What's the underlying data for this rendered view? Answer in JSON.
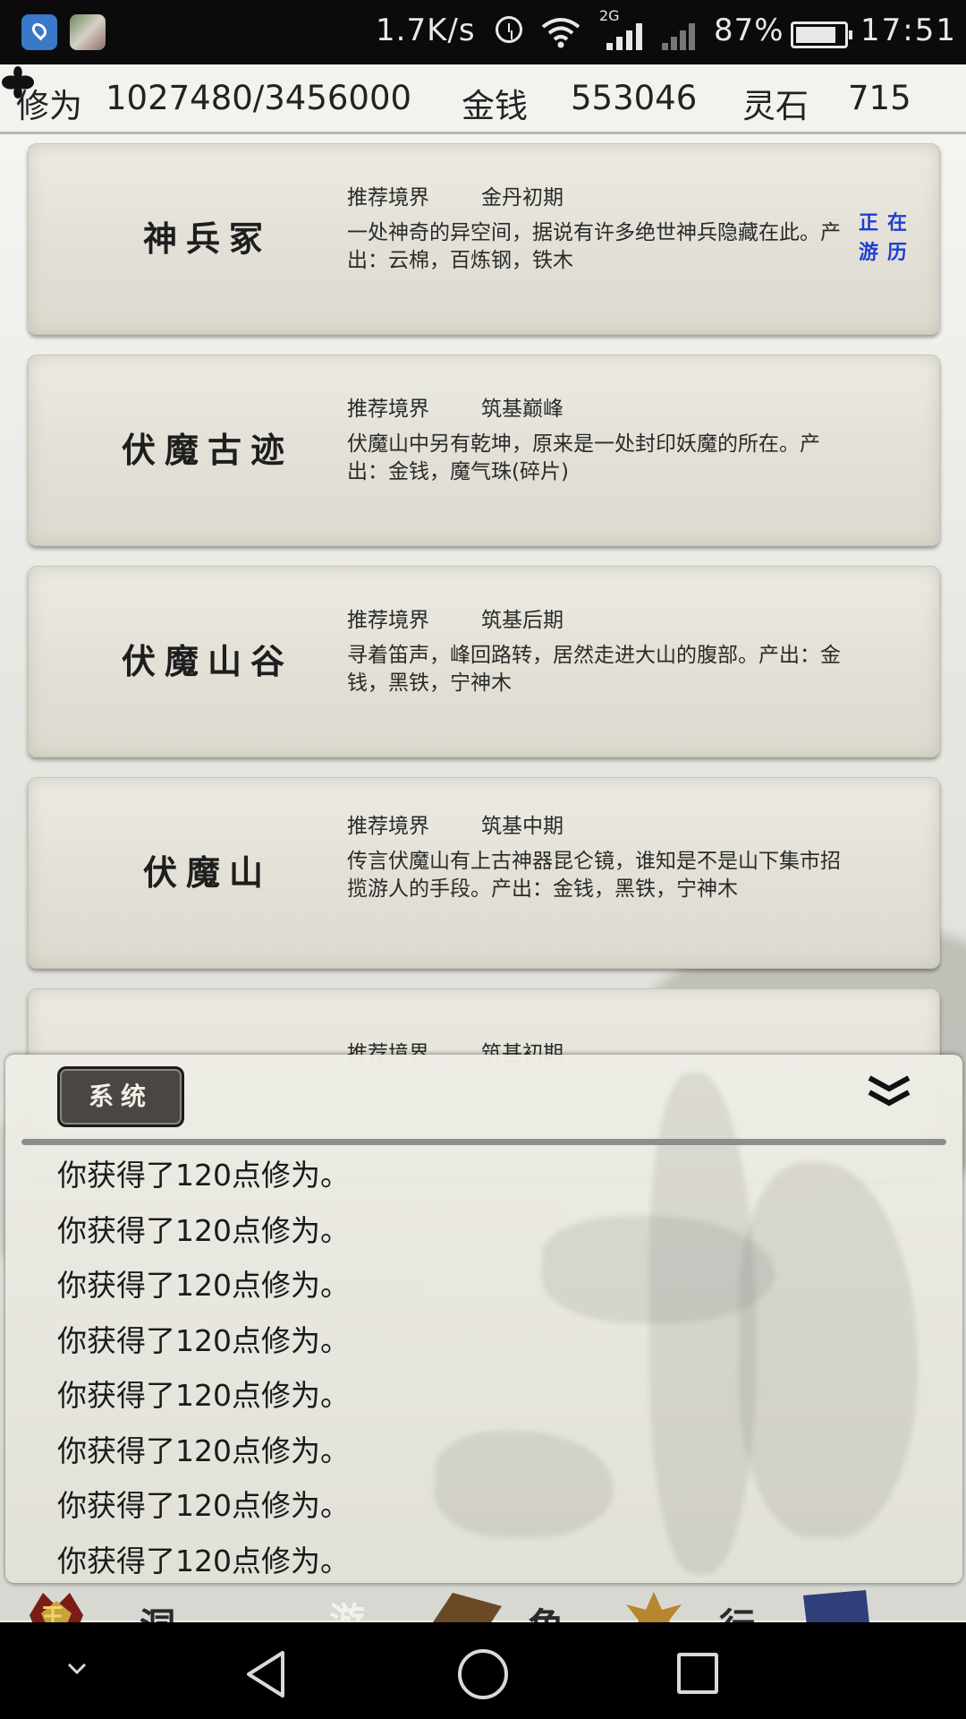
{
  "status_bar": {
    "speed": "1.7K/s",
    "network_type": "2G",
    "battery": "87%",
    "time": "17:51"
  },
  "resources": {
    "cultivation_label": "修为",
    "cultivation_value": "1027480/3456000",
    "money_label": "金钱",
    "money_value": "553046",
    "spirit_stone_label": "灵石",
    "spirit_stone_value": "715"
  },
  "locations": [
    {
      "name": "神兵冢",
      "rec_label": "推荐境界",
      "rec_value": "金丹初期",
      "desc": "一处神奇的异空间，据说有许多绝世神兵隐藏在此。产出：云棉，百炼钢，铁木",
      "status": "正在游历"
    },
    {
      "name": "伏魔古迹",
      "rec_label": "推荐境界",
      "rec_value": "筑基巅峰",
      "desc": "伏魔山中另有乾坤，原来是一处封印妖魔的所在。产出：金钱，魔气珠(碎片)"
    },
    {
      "name": "伏魔山谷",
      "rec_label": "推荐境界",
      "rec_value": "筑基后期",
      "desc": "寻着笛声，峰回路转，居然走进大山的腹部。产出：金钱，黑铁，宁神木"
    },
    {
      "name": "伏魔山",
      "rec_label": "推荐境界",
      "rec_value": "筑基中期",
      "desc": "传言伏魔山有上古神器昆仑镜，谁知是不是山下集市招揽游人的手段。产出：金钱，黑铁，宁神木"
    },
    {
      "name": "",
      "rec_label": "推荐境界",
      "rec_value": "筑基初期",
      "desc": ""
    }
  ],
  "log": {
    "tab_label": "系统",
    "lines": [
      "你获得了120点修为。",
      "你获得了120点修为。",
      "你获得了120点修为。",
      "你获得了120点修为。",
      "你获得了120点修为。",
      "你获得了120点修为。",
      "你获得了120点修为。",
      "你获得了120点修为。"
    ]
  },
  "game_tabs": [
    "王",
    "洞",
    "游",
    "角",
    "行"
  ],
  "colors": {
    "status_text": "#1d3fd6",
    "card_bg": "#e4e2d8",
    "tab_bg": "#4a4642"
  }
}
